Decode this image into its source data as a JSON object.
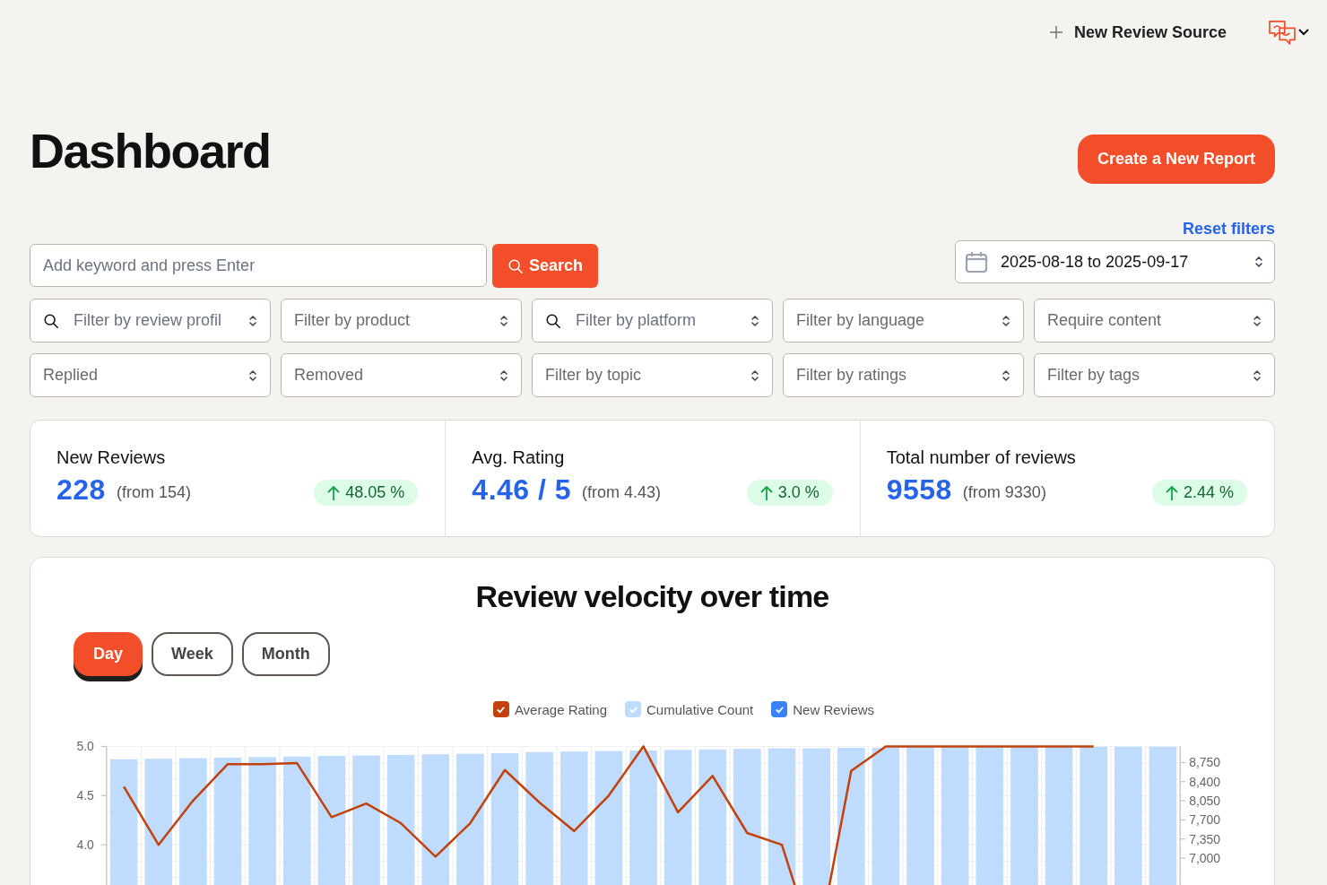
{
  "header": {
    "new_source_label": "New Review Source"
  },
  "title": "Dashboard",
  "create_button": "Create a New Report",
  "reset_filters": "Reset filters",
  "keyword": {
    "placeholder": "Add keyword and press Enter"
  },
  "search_button": "Search",
  "date_range": "2025-08-18 to 2025-09-17",
  "filters": [
    {
      "kind": "search",
      "label": "Filter by review profil"
    },
    {
      "kind": "select",
      "label": "Filter by product"
    },
    {
      "kind": "search",
      "label": "Filter by platform"
    },
    {
      "kind": "select",
      "label": "Filter by language"
    },
    {
      "kind": "select",
      "label": "Require content"
    },
    {
      "kind": "select",
      "label": "Replied"
    },
    {
      "kind": "select",
      "label": "Removed"
    },
    {
      "kind": "select",
      "label": "Filter by topic"
    },
    {
      "kind": "select",
      "label": "Filter by ratings"
    },
    {
      "kind": "select",
      "label": "Filter by tags"
    }
  ],
  "stats": [
    {
      "label": "New Reviews",
      "value": "228",
      "from": "(from 154)",
      "change": "48.05 %"
    },
    {
      "label": "Avg. Rating",
      "value": "4.46 / 5",
      "from": "(from 4.43)",
      "change": "3.0 %"
    },
    {
      "label": "Total number of reviews",
      "value": "9558",
      "from": "(from 9330)",
      "change": "2.44 %"
    }
  ],
  "velocity": {
    "title": "Review velocity over time",
    "periods": [
      {
        "label": "Day",
        "selected": true
      },
      {
        "label": "Week",
        "selected": false
      },
      {
        "label": "Month",
        "selected": false
      }
    ],
    "legend": [
      {
        "checked": true
      },
      {
        "checked": true
      },
      {
        "label": "New Reviews",
        "checked": true,
        "color": "#3b82f6"
      }
    ],
    "chart_data": {
      "type": "bar",
      "grid": true,
      "ylim": [
        2.5,
        5.0
      ],
      "yticks": [
        {
          "value": 4,
          "label": "4.0"
        },
        {
          "value": 4.5,
          "label": "4.5"
        },
        {
          "value": 5,
          "label": "5.0"
        }
      ],
      "y2lim": [
        4544,
        9045
      ],
      "y2ticks": [
        {
          "value": 7000,
          "label": "7,000"
        },
        {
          "value": 7350,
          "label": "7,350"
        },
        {
          "value": 7700,
          "label": "7,700"
        },
        {
          "value": 8050,
          "label": "8,050"
        },
        {
          "value": 8400,
          "label": "8,400"
        },
        {
          "value": 8750,
          "label": "8,750"
        }
      ],
      "series": [
        {
          "name": "Average Rating",
          "type": "line",
          "color": "#c2410c",
          "values": [
            4.59,
            4.0,
            4.45,
            4.82,
            4.82,
            4.83,
            4.28,
            4.42,
            4.22,
            3.88,
            4.22,
            4.76,
            4.43,
            4.14,
            4.5,
            5.0,
            4.33,
            4.7,
            4.12,
            4.0,
            2.9,
            4.75,
            5.0,
            5.0,
            5.0,
            5.0,
            5.0,
            5.0,
            5.0,
            null,
            null
          ]
        },
        {
          "name": "Cumulative Count",
          "type": "bar",
          "axis": "y2",
          "color": "#bfdbfe",
          "values": [
            8810,
            8820,
            8830,
            8840,
            8850,
            8860,
            8870,
            8880,
            8890,
            8900,
            8910,
            8920,
            8940,
            8950,
            8960,
            8970,
            8980,
            8990,
            9000,
            9010,
            9010,
            9020,
            9020,
            9030,
            9030,
            9030,
            9040,
            9040,
            9040,
            9040,
            9040
          ]
        }
      ]
    }
  }
}
